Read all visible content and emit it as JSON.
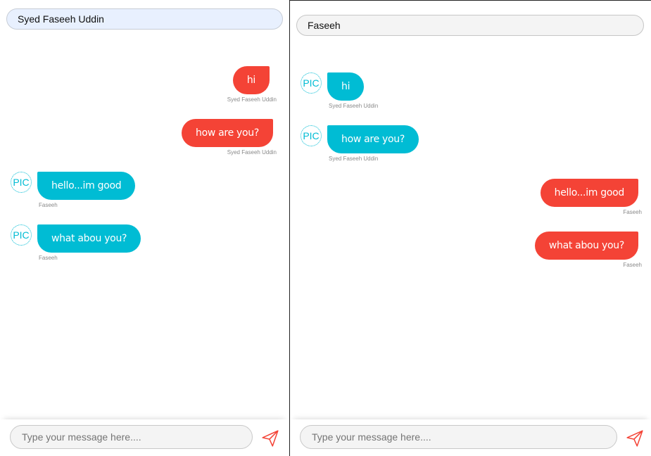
{
  "left": {
    "name": "Syed Faseeh Uddin",
    "messages": [
      {
        "text": "hi",
        "sender": "Syed Faseeh Uddin"
      },
      {
        "text": "how are you?",
        "sender": "Syed Faseeh Uddin"
      },
      {
        "text": "hello...im good",
        "sender": "Faseeh",
        "avatar": "PIC"
      },
      {
        "text": "what abou you?",
        "sender": "Faseeh",
        "avatar": "PIC"
      }
    ],
    "input_placeholder": "Type your message here...."
  },
  "right": {
    "name": "Faseeh",
    "messages": [
      {
        "text": "hi",
        "sender": "Syed Faseeh Uddin",
        "avatar": "PIC"
      },
      {
        "text": "how are you?",
        "sender": "Syed Faseeh Uddin",
        "avatar": "PIC"
      },
      {
        "text": "hello...im good",
        "sender": "Faseeh"
      },
      {
        "text": "what abou you?",
        "sender": "Faseeh"
      }
    ],
    "input_placeholder": "Type your message here...."
  },
  "colors": {
    "sent": "#f44336",
    "received": "#00bcd4"
  },
  "icons": {
    "send": "send-icon",
    "avatar": "pic-avatar"
  }
}
